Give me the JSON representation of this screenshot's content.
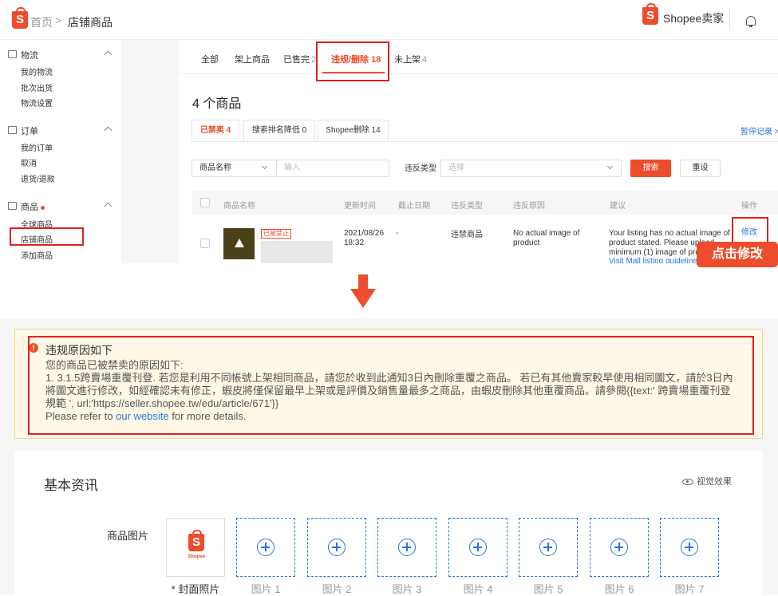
{
  "header": {
    "home": "首页",
    "separator": ">",
    "current": "店铺商品",
    "seller_center": "Shopee卖家",
    "logo_letter": "S"
  },
  "sidebar": {
    "sections": [
      {
        "title": "物流",
        "items": [
          "我的物流",
          "批次出货",
          "物流设置"
        ]
      },
      {
        "title": "订单",
        "items": [
          "我的订单",
          "取消",
          "退货/退款"
        ]
      },
      {
        "title": "商品",
        "items": [
          "全球商品",
          "店铺商品",
          "添加商品"
        ]
      }
    ]
  },
  "tabs": [
    {
      "label": "全部",
      "count": ""
    },
    {
      "label": "架上商品",
      "count": ""
    },
    {
      "label": "已售完",
      "count": "2"
    },
    {
      "label": "违规/删除 18",
      "count": ""
    },
    {
      "label": "未上架",
      "count": "4"
    }
  ],
  "main": {
    "count_title": "4 个商品",
    "subtabs": [
      "已禁卖 4",
      "搜索排名降低 0",
      "Shopee删除 14"
    ],
    "right_link": "暂停记录 >",
    "filter_field": "商品名称",
    "input_placeholder": "输入",
    "violation_type_label": "违反类型",
    "select_placeholder": "选择",
    "search_button": "搜索",
    "reset_button": "重设"
  },
  "table": {
    "columns": [
      "商品名称",
      "更新时间",
      "截止日期",
      "违反类型",
      "违反原因",
      "建议",
      "操作"
    ],
    "row": {
      "badge": "已被禁止",
      "update_date": "2021/08/26",
      "update_time": "18:32",
      "deadline": "-",
      "violation_type": "违禁商品",
      "reason_line1": "No actual image of",
      "reason_line2": "product",
      "suggestion_line1": "Your listing has no actual image of",
      "suggestion_line2": "product stated. Please upload",
      "suggestion_line3": "minimum (1) image of pro",
      "suggestion_line4": "Visit Mall listing guideline",
      "action": "修改"
    }
  },
  "callout": "点击修改",
  "notice": {
    "icon": "!",
    "title": "违规原因如下",
    "line1": "您的商品已被禁卖的原因如下:",
    "line2": "1. 3.1.5跨賣場重覆刊登. 若您是利用不同帳號上架相同商品，請您於收到此通知3日內刪除重覆之商品。 若已有其他賣家較早使用相同圖文，請於3日內",
    "line3": "將圖文進行修改，如經確認未有修正，蝦皮將僅保留最早上架或是評價及銷售量最多之商品，由蝦皮刪除其他重覆商品。請參閱{{text:' 跨賣場重覆刊登",
    "line4": "規範 ', url:'https://seller.shopee.tw/edu/article/671'}}",
    "line5_pre": "Please refer to ",
    "line5_link": "our website",
    "line5_post": " for more details."
  },
  "basic_info": {
    "title": "基本资讯",
    "preview": "视觉效果",
    "field_label": "商品图片",
    "cover_logo_text": "Shopee",
    "cover_label": "* 封面照片",
    "slot_labels": [
      "图片 1",
      "图片 2",
      "图片 3",
      "图片 4",
      "图片 5",
      "图片 6",
      "图片 7"
    ]
  },
  "colors": {
    "brand": "#ee4d2d",
    "link": "#2673dd",
    "highlight": "#e02020",
    "notice_bg": "#fff8e6"
  }
}
